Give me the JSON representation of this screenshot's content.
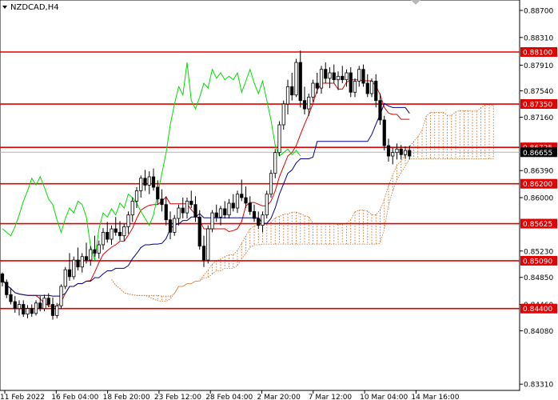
{
  "header": {
    "symbol_label": "NZDCAD,H4"
  },
  "chart_data": {
    "type": "candlestick",
    "title": "NZDCAD,H4",
    "ylim": [
      0.8322,
      0.8885
    ],
    "price_ticks": [
      "0.88700",
      "0.88310",
      "0.87910",
      "0.87540",
      "0.87160",
      "0.86390",
      "0.86000",
      "0.85230",
      "0.84850",
      "0.84460",
      "0.84080",
      "0.83310"
    ],
    "time_ticks": [
      "11 Feb 2022",
      "16 Feb 04:00",
      "18 Feb 20:00",
      "23 Feb 12:00",
      "28 Feb 04:00",
      "2 Mar 20:00",
      "7 Mar 12:00",
      "10 Mar 04:00",
      "14 Mar 16:00"
    ],
    "levels": [
      {
        "label": "0.88100",
        "value": 0.881
      },
      {
        "label": "0.87350",
        "value": 0.8735
      },
      {
        "label": "0.86725",
        "value": 0.86725
      },
      {
        "label": "0.86200",
        "value": 0.862
      },
      {
        "label": "0.85625",
        "value": 0.85625
      },
      {
        "label": "0.85090",
        "value": 0.8509
      },
      {
        "label": "0.84400",
        "value": 0.844
      }
    ],
    "current_price": {
      "label": "0.86655",
      "value": 0.86655
    },
    "colors": {
      "level_line": "#e00000",
      "level_label_bg": "#e00000",
      "candles": "#000000",
      "tenkan": "#e00000",
      "kijun": "#00008b",
      "chikou": "#00dd00",
      "cloud": "#d2691e",
      "current_line": "#b0b0b0"
    },
    "candles": [
      [
        0.849,
        0.8492,
        0.8472,
        0.8478
      ],
      [
        0.8478,
        0.8482,
        0.8455,
        0.846
      ],
      [
        0.846,
        0.847,
        0.8446,
        0.845
      ],
      [
        0.845,
        0.8458,
        0.8434,
        0.844
      ],
      [
        0.844,
        0.8452,
        0.843,
        0.8446
      ],
      [
        0.8446,
        0.8452,
        0.8428,
        0.8432
      ],
      [
        0.8432,
        0.8445,
        0.8426,
        0.844
      ],
      [
        0.844,
        0.8446,
        0.8428,
        0.8433
      ],
      [
        0.8433,
        0.8452,
        0.843,
        0.8448
      ],
      [
        0.8448,
        0.8458,
        0.8436,
        0.844
      ],
      [
        0.844,
        0.846,
        0.8436,
        0.8455
      ],
      [
        0.8455,
        0.8462,
        0.8442,
        0.8446
      ],
      [
        0.8446,
        0.8456,
        0.8424,
        0.843
      ],
      [
        0.843,
        0.8448,
        0.8426,
        0.8444
      ],
      [
        0.8444,
        0.8475,
        0.844,
        0.8472
      ],
      [
        0.8472,
        0.85,
        0.8468,
        0.8496
      ],
      [
        0.8496,
        0.852,
        0.848,
        0.8486
      ],
      [
        0.8486,
        0.8515,
        0.8482,
        0.851
      ],
      [
        0.851,
        0.8528,
        0.8495,
        0.85
      ],
      [
        0.85,
        0.852,
        0.8492,
        0.8515
      ],
      [
        0.8515,
        0.8535,
        0.8505,
        0.851
      ],
      [
        0.851,
        0.853,
        0.8502,
        0.8525
      ],
      [
        0.8525,
        0.8545,
        0.8515,
        0.852
      ],
      [
        0.852,
        0.8538,
        0.8512,
        0.8532
      ],
      [
        0.8532,
        0.8556,
        0.8525,
        0.855
      ],
      [
        0.855,
        0.8565,
        0.8535,
        0.854
      ],
      [
        0.854,
        0.856,
        0.8532,
        0.8555
      ],
      [
        0.8555,
        0.8572,
        0.8545,
        0.855
      ],
      [
        0.855,
        0.8566,
        0.8538,
        0.8545
      ],
      [
        0.8545,
        0.8562,
        0.8538,
        0.8558
      ],
      [
        0.8558,
        0.858,
        0.8548,
        0.8575
      ],
      [
        0.8575,
        0.86,
        0.8565,
        0.8595
      ],
      [
        0.8595,
        0.8615,
        0.8585,
        0.861
      ],
      [
        0.861,
        0.8632,
        0.86,
        0.8628
      ],
      [
        0.8628,
        0.864,
        0.861,
        0.8618
      ],
      [
        0.8618,
        0.8638,
        0.8605,
        0.863
      ],
      [
        0.863,
        0.8642,
        0.861,
        0.8615
      ],
      [
        0.8615,
        0.8625,
        0.859,
        0.8598
      ],
      [
        0.8598,
        0.8612,
        0.858,
        0.859
      ],
      [
        0.859,
        0.8602,
        0.856,
        0.8568
      ],
      [
        0.8568,
        0.858,
        0.854,
        0.855
      ],
      [
        0.855,
        0.8575,
        0.8545,
        0.857
      ],
      [
        0.857,
        0.859,
        0.856,
        0.8585
      ],
      [
        0.8585,
        0.86,
        0.857,
        0.8578
      ],
      [
        0.8578,
        0.86,
        0.857,
        0.8595
      ],
      [
        0.8595,
        0.861,
        0.8585,
        0.859
      ],
      [
        0.859,
        0.8602,
        0.8565,
        0.8572
      ],
      [
        0.8572,
        0.8582,
        0.8525,
        0.853
      ],
      [
        0.853,
        0.8545,
        0.85,
        0.851
      ],
      [
        0.851,
        0.856,
        0.8505,
        0.8555
      ],
      [
        0.8555,
        0.8582,
        0.855,
        0.8578
      ],
      [
        0.8578,
        0.859,
        0.8565,
        0.8572
      ],
      [
        0.8572,
        0.8588,
        0.856,
        0.8584
      ],
      [
        0.8584,
        0.8595,
        0.857,
        0.8575
      ],
      [
        0.8575,
        0.8598,
        0.857,
        0.8592
      ],
      [
        0.8592,
        0.8605,
        0.858,
        0.8585
      ],
      [
        0.8585,
        0.861,
        0.8578,
        0.8605
      ],
      [
        0.8605,
        0.8626,
        0.8595,
        0.86
      ],
      [
        0.86,
        0.8616,
        0.8585,
        0.8592
      ],
      [
        0.8592,
        0.8602,
        0.8575,
        0.858
      ],
      [
        0.858,
        0.859,
        0.8565,
        0.857
      ],
      [
        0.857,
        0.858,
        0.8555,
        0.856
      ],
      [
        0.856,
        0.858,
        0.855,
        0.8575
      ],
      [
        0.8575,
        0.861,
        0.857,
        0.8605
      ],
      [
        0.8605,
        0.864,
        0.86,
        0.8635
      ],
      [
        0.8635,
        0.867,
        0.8628,
        0.8665
      ],
      [
        0.8665,
        0.871,
        0.866,
        0.8705
      ],
      [
        0.8705,
        0.874,
        0.8698,
        0.8735
      ],
      [
        0.8735,
        0.877,
        0.872,
        0.876
      ],
      [
        0.876,
        0.878,
        0.874,
        0.8748
      ],
      [
        0.8748,
        0.88,
        0.8745,
        0.8795
      ],
      [
        0.8795,
        0.8812,
        0.873,
        0.874
      ],
      [
        0.874,
        0.876,
        0.872,
        0.8728
      ],
      [
        0.8728,
        0.875,
        0.8718,
        0.8745
      ],
      [
        0.8745,
        0.877,
        0.8738,
        0.8765
      ],
      [
        0.8765,
        0.878,
        0.875,
        0.8758
      ],
      [
        0.8758,
        0.879,
        0.875,
        0.8785
      ],
      [
        0.8785,
        0.8795,
        0.8765,
        0.8772
      ],
      [
        0.8772,
        0.8788,
        0.8758,
        0.878
      ],
      [
        0.878,
        0.8792,
        0.8765,
        0.877
      ],
      [
        0.877,
        0.8782,
        0.8755,
        0.8775
      ],
      [
        0.8775,
        0.879,
        0.8765,
        0.877
      ],
      [
        0.877,
        0.8785,
        0.876,
        0.878
      ],
      [
        0.878,
        0.8788,
        0.8745,
        0.8752
      ],
      [
        0.8752,
        0.8772,
        0.8745,
        0.8768
      ],
      [
        0.8768,
        0.879,
        0.876,
        0.8785
      ],
      [
        0.8785,
        0.8792,
        0.876,
        0.8765
      ],
      [
        0.8765,
        0.8778,
        0.8745,
        0.875
      ],
      [
        0.875,
        0.8772,
        0.8745,
        0.8768
      ],
      [
        0.8768,
        0.8778,
        0.873,
        0.874
      ],
      [
        0.874,
        0.875,
        0.8705,
        0.8712
      ],
      [
        0.8712,
        0.8718,
        0.8668,
        0.8675
      ],
      [
        0.8675,
        0.8685,
        0.8652,
        0.866
      ],
      [
        0.866,
        0.8672,
        0.8648,
        0.8665
      ],
      [
        0.8665,
        0.8678,
        0.8655,
        0.867
      ],
      [
        0.867,
        0.8676,
        0.8655,
        0.8662
      ],
      [
        0.8662,
        0.8674,
        0.8656,
        0.8668
      ],
      [
        0.8668,
        0.8675,
        0.8655,
        0.866
      ]
    ]
  }
}
